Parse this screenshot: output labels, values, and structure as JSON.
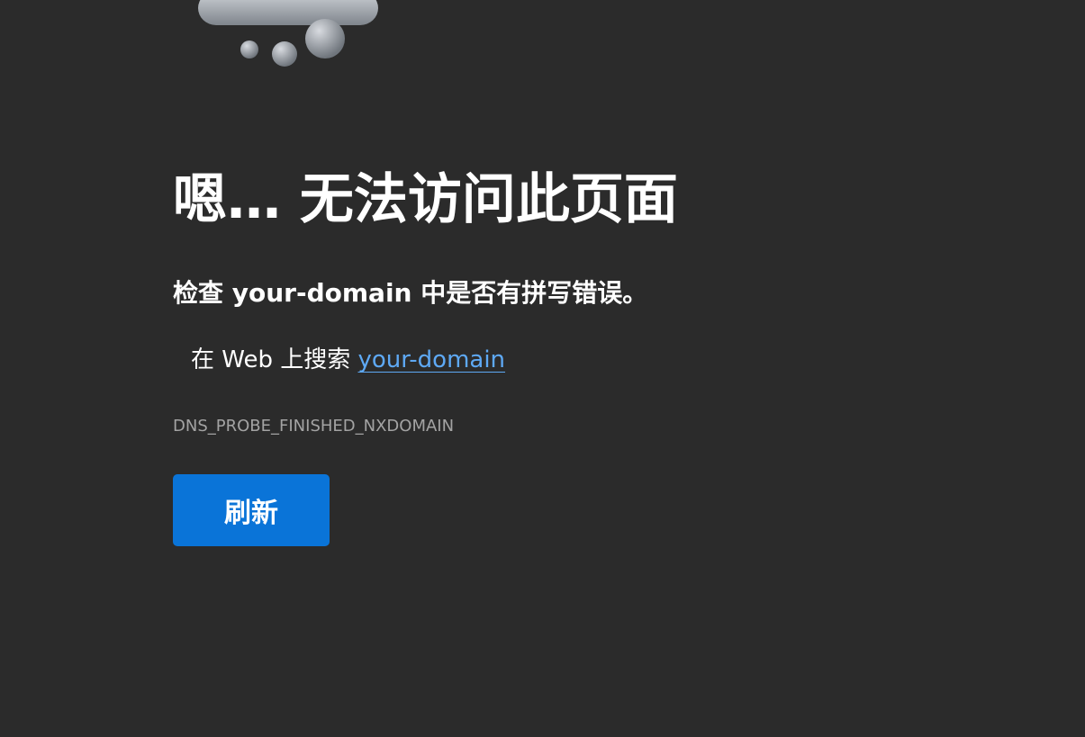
{
  "illustration": {
    "icon": "rain-cloud-icon",
    "cloud_color": "#a9aeb5",
    "drop_color": "#8f949b"
  },
  "error_page": {
    "title": "嗯… 无法访问此页面",
    "subtitle": "检查 your-domain 中是否有拼写错误。",
    "search_prefix": "在 Web 上搜索 ",
    "search_link": "your-domain",
    "error_code": "DNS_PROBE_FINISHED_NXDOMAIN",
    "refresh_label": "刷新"
  },
  "colors": {
    "background": "#2b2b2b",
    "text": "#ffffff",
    "link": "#5ea9f5",
    "muted": "#a3a3a3",
    "button": "#0a74d8"
  }
}
